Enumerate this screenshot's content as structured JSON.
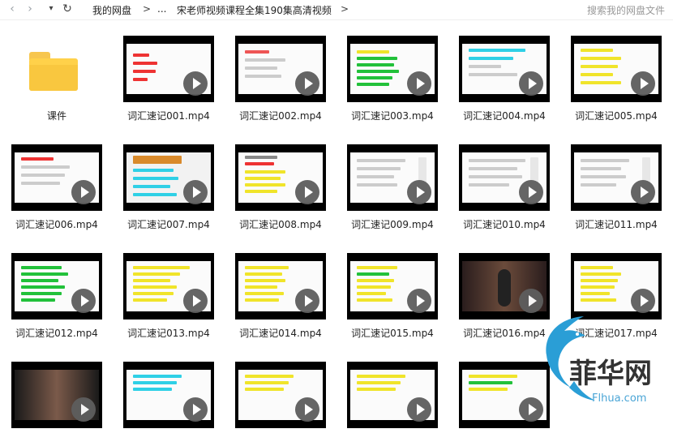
{
  "topbar": {
    "back": "‹",
    "forward": "›",
    "dropdown": "▾",
    "refresh": "↻",
    "crumbs": [
      "我的网盘",
      "...",
      "宋老师视频课程全集190集高清视频"
    ],
    "sep": ">",
    "search_placeholder": "搜索我的网盘文件"
  },
  "items": [
    {
      "label": "课件",
      "type": "folder"
    },
    {
      "label": "词汇速记001.mp4",
      "type": "video"
    },
    {
      "label": "词汇速记002.mp4",
      "type": "video"
    },
    {
      "label": "词汇速记003.mp4",
      "type": "video"
    },
    {
      "label": "词汇速记004.mp4",
      "type": "video"
    },
    {
      "label": "词汇速记005.mp4",
      "type": "video"
    },
    {
      "label": "词汇速记006.mp4",
      "type": "video"
    },
    {
      "label": "词汇速记007.mp4",
      "type": "video"
    },
    {
      "label": "词汇速记008.mp4",
      "type": "video"
    },
    {
      "label": "词汇速记009.mp4",
      "type": "video"
    },
    {
      "label": "词汇速记010.mp4",
      "type": "video"
    },
    {
      "label": "词汇速记011.mp4",
      "type": "video"
    },
    {
      "label": "词汇速记012.mp4",
      "type": "video"
    },
    {
      "label": "词汇速记013.mp4",
      "type": "video"
    },
    {
      "label": "词汇速记014.mp4",
      "type": "video"
    },
    {
      "label": "词汇速记015.mp4",
      "type": "video"
    },
    {
      "label": "词汇速记016.mp4",
      "type": "video"
    },
    {
      "label": "词汇速记017.mp4",
      "type": "video"
    },
    {
      "label": "",
      "type": "video"
    },
    {
      "label": "",
      "type": "video"
    },
    {
      "label": "",
      "type": "video"
    },
    {
      "label": "",
      "type": "video"
    },
    {
      "label": "",
      "type": "video"
    }
  ],
  "watermark": {
    "brand": "菲华网",
    "url": "Flhua.com"
  },
  "colors": {
    "yellow_highlight": "#f0e42a",
    "green_highlight": "#22c13a",
    "cyan_highlight": "#2fd0e6",
    "folder": "#ffd14a"
  }
}
